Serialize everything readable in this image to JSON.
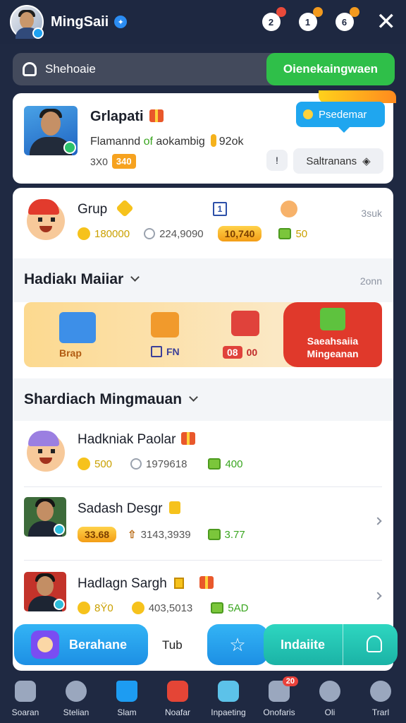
{
  "header": {
    "username": "MingSaii",
    "badge_glyph": "✦",
    "icons": [
      {
        "name": "notification-icon",
        "glyph": "2"
      },
      {
        "name": "message-icon",
        "glyph": "1"
      },
      {
        "name": "gift-icon",
        "glyph": "6"
      }
    ],
    "close_glyph": "✕"
  },
  "search": {
    "placeholder": "Shehoaie",
    "button_label": "Oienekaingwaen"
  },
  "profile": {
    "name": "Grlapati",
    "subtitle_a": "Flamannd",
    "subtitle_b": "of",
    "subtitle_c": "aokambig",
    "subtitle_amount": "92ok",
    "level_text": "3X0",
    "level_pill": "340",
    "tooltip_label": "Psedemar",
    "info_glyph": "!",
    "secondary_button": "Saltranans"
  },
  "group_row": {
    "name": "Grup",
    "icon_box": "1",
    "stat_coin": "180000",
    "stat_clock": "224,9090",
    "stat_pill": "10,740",
    "stat_chest": "50",
    "time": "3suk"
  },
  "section1": {
    "title": "Hadiakı Maiiar",
    "time": "2onn"
  },
  "banner": {
    "label_box": "Brap",
    "label_fn": "FN",
    "label_count": "08",
    "label_count_suffix": "00",
    "cta_line1": "Saeahsaiia",
    "cta_line2": "Mingeanan"
  },
  "section2": {
    "title": "Shardiach Mingmauan"
  },
  "list": [
    {
      "name": "Hadkniak Paolar",
      "coin": "500",
      "clock": "1979618",
      "chest": "400"
    },
    {
      "name": "Sadash Desgr",
      "pill": "33.68",
      "up": "3143,3939",
      "chest": "3.77"
    },
    {
      "name": "Hadlagn Sargh",
      "coin": "8Ÿ0",
      "coin2": "403,5013",
      "chest": "5AD"
    }
  ],
  "actionbar": {
    "left_label": "Berahane",
    "middle_label": "Tub",
    "star_glyph": "☆",
    "right_label": "Indaiite"
  },
  "bottomnav": [
    {
      "label": "Soaran"
    },
    {
      "label": "Stelian"
    },
    {
      "label": "Slam"
    },
    {
      "label": "Noafar"
    },
    {
      "label": "Inpaeting"
    },
    {
      "label": "Onofaris",
      "badge": "20"
    },
    {
      "label": "Oli"
    },
    {
      "label": "Trarl"
    }
  ],
  "colors": {
    "background": "#1f2942",
    "accent_green": "#2fbf49",
    "accent_blue": "#1d9cf2",
    "accent_teal": "#1bb3a6",
    "gold": "#f6a21f"
  }
}
